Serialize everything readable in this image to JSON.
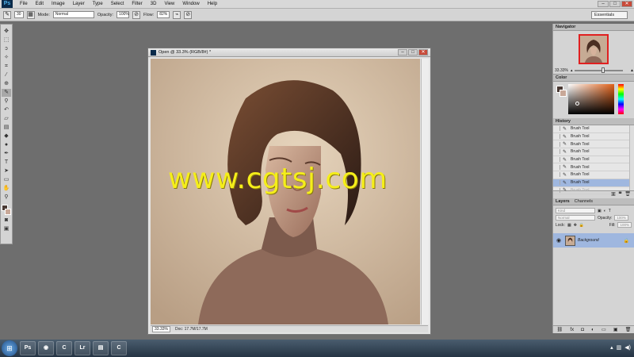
{
  "app": {
    "logo": "Ps"
  },
  "menu": [
    "File",
    "Edit",
    "Image",
    "Layer",
    "Type",
    "Select",
    "Filter",
    "3D",
    "View",
    "Window",
    "Help"
  ],
  "window_controls": {
    "minimize": "–",
    "maximize": "□",
    "close": "✕"
  },
  "options": {
    "brush_size": "30",
    "mode_label": "Mode:",
    "mode_value": "Normal",
    "opacity_label": "Opacity:",
    "opacity_value": "100%",
    "flow_label": "Flow:",
    "flow_value": "82%",
    "workspace": "Essentials"
  },
  "document": {
    "title": "Open @ 33.3% (RGB/8#) *",
    "zoom": "33.33%",
    "doc_info": "Doc: 17.7M/17.7M"
  },
  "watermark": "www.cgtsj.com",
  "navigator": {
    "tab": "Navigator",
    "zoom": "33.33%"
  },
  "color": {
    "tab": "Color",
    "fg": "#4a3a34",
    "bg": "#c8a898"
  },
  "history": {
    "tab": "History",
    "items": [
      {
        "label": "Brush Tool"
      },
      {
        "label": "Brush Tool"
      },
      {
        "label": "Brush Tool"
      },
      {
        "label": "Brush Tool"
      },
      {
        "label": "Brush Tool"
      },
      {
        "label": "Brush Tool"
      },
      {
        "label": "Brush Tool"
      },
      {
        "label": "Brush Tool",
        "state": "selected"
      },
      {
        "label": "Brush Tool",
        "state": "faded"
      }
    ]
  },
  "layers": {
    "tabs": [
      "Layers",
      "Channels"
    ],
    "kind_placeholder": "Kind",
    "blend_mode": "Normal",
    "opacity_label": "Opacity:",
    "opacity_value": "100%",
    "lock_label": "Lock:",
    "fill_label": "Fill:",
    "fill_value": "100%",
    "layer_name": "Background"
  },
  "taskbar": {
    "start": "⊞",
    "apps": [
      "Ps",
      "◉",
      "C",
      "Lr",
      "▤",
      "C"
    ]
  }
}
